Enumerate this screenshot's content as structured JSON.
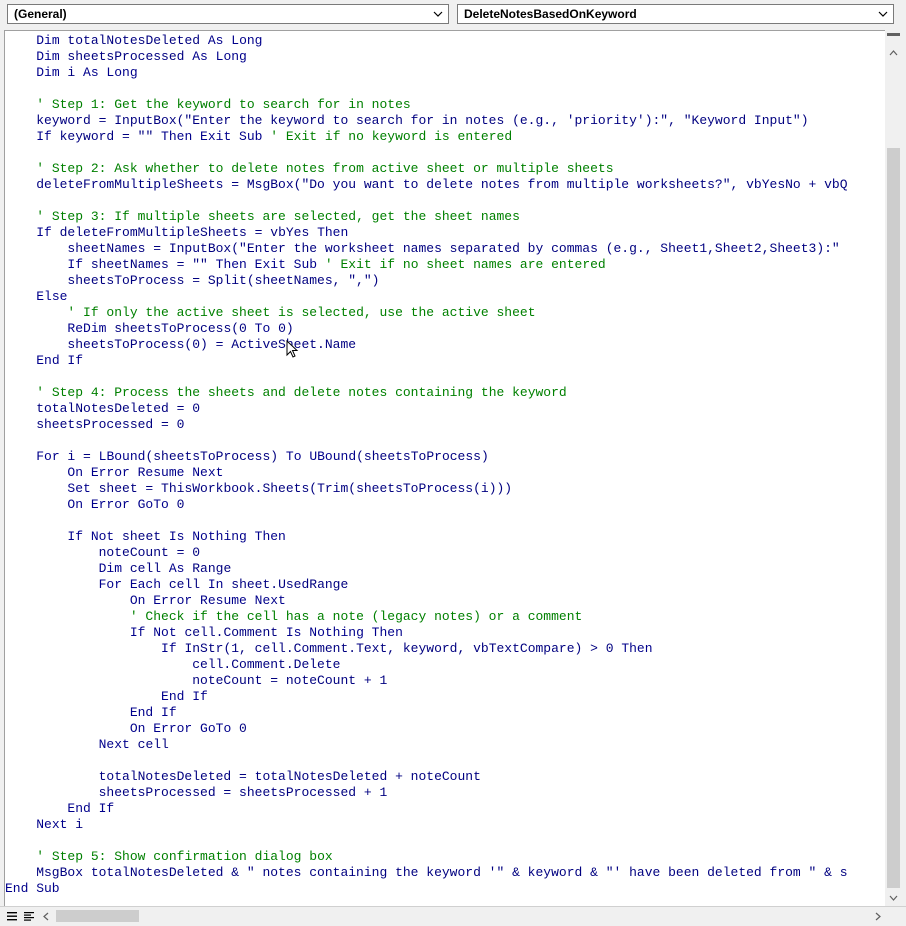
{
  "window": {
    "object_dropdown": "(General)",
    "procedure_dropdown": "DeleteNotesBasedOnKeyword"
  },
  "colors": {
    "keyword": "#00008b",
    "comment": "#008000",
    "text": "#000080"
  },
  "code_lines": [
    [
      {
        "t": "    "
      },
      {
        "k": "Dim"
      },
      {
        "t": " totalNotesDeleted "
      },
      {
        "k": "As Long"
      }
    ],
    [
      {
        "t": "    "
      },
      {
        "k": "Dim"
      },
      {
        "t": " sheetsProcessed "
      },
      {
        "k": "As Long"
      }
    ],
    [
      {
        "t": "    "
      },
      {
        "k": "Dim"
      },
      {
        "t": " i "
      },
      {
        "k": "As Long"
      }
    ],
    [],
    [
      {
        "t": "    "
      },
      {
        "c": "' Step 1: Get the keyword to search for in notes"
      }
    ],
    [
      {
        "t": "    keyword = InputBox(\"Enter the keyword to search for in notes (e.g., 'priority'):\", \"Keyword Input\")"
      }
    ],
    [
      {
        "t": "    "
      },
      {
        "k": "If"
      },
      {
        "t": " keyword = \"\" "
      },
      {
        "k": "Then Exit Sub"
      },
      {
        "t": " "
      },
      {
        "c": "' Exit if no keyword is entered"
      }
    ],
    [],
    [
      {
        "t": "    "
      },
      {
        "c": "' Step 2: Ask whether to delete notes from active sheet or multiple sheets"
      }
    ],
    [
      {
        "t": "    deleteFromMultipleSheets = MsgBox(\"Do you want to delete notes from multiple worksheets?\", vbYesNo + vbQ"
      }
    ],
    [],
    [
      {
        "t": "    "
      },
      {
        "c": "' Step 3: If multiple sheets are selected, get the sheet names"
      }
    ],
    [
      {
        "t": "    "
      },
      {
        "k": "If"
      },
      {
        "t": " deleteFromMultipleSheets = vbYes "
      },
      {
        "k": "Then"
      }
    ],
    [
      {
        "t": "        sheetNames = InputBox(\"Enter the worksheet names separated by commas (e.g., Sheet1,Sheet2,Sheet3):\""
      }
    ],
    [
      {
        "t": "        "
      },
      {
        "k": "If"
      },
      {
        "t": " sheetNames = \"\" "
      },
      {
        "k": "Then Exit Sub"
      },
      {
        "t": " "
      },
      {
        "c": "' Exit if no sheet names are entered"
      }
    ],
    [
      {
        "t": "        sheetsToProcess = Split(sheetNames, \",\")"
      }
    ],
    [
      {
        "t": "    "
      },
      {
        "k": "Else"
      }
    ],
    [
      {
        "t": "        "
      },
      {
        "c": "' If only the active sheet is selected, use the active sheet"
      }
    ],
    [
      {
        "t": "        "
      },
      {
        "k": "ReDim"
      },
      {
        "t": " sheetsToProcess(0 "
      },
      {
        "k": "To"
      },
      {
        "t": " 0)"
      }
    ],
    [
      {
        "t": "        sheetsToProcess(0) = ActiveSheet.Name"
      }
    ],
    [
      {
        "t": "    "
      },
      {
        "k": "End If"
      }
    ],
    [],
    [
      {
        "t": "    "
      },
      {
        "c": "' Step 4: Process the sheets and delete notes containing the keyword"
      }
    ],
    [
      {
        "t": "    totalNotesDeleted = 0"
      }
    ],
    [
      {
        "t": "    sheetsProcessed = 0"
      }
    ],
    [],
    [
      {
        "t": "    "
      },
      {
        "k": "For"
      },
      {
        "t": " i = "
      },
      {
        "k": "LBound"
      },
      {
        "t": "(sheetsToProcess) "
      },
      {
        "k": "To"
      },
      {
        "t": " "
      },
      {
        "k": "UBound"
      },
      {
        "t": "(sheetsToProcess)"
      }
    ],
    [
      {
        "t": "        "
      },
      {
        "k": "On Error Resume Next"
      }
    ],
    [
      {
        "t": "        "
      },
      {
        "k": "Set"
      },
      {
        "t": " sheet = ThisWorkbook.Sheets(Trim(sheetsToProcess(i)))"
      }
    ],
    [
      {
        "t": "        "
      },
      {
        "k": "On Error GoTo"
      },
      {
        "t": " 0"
      }
    ],
    [],
    [
      {
        "t": "        "
      },
      {
        "k": "If Not"
      },
      {
        "t": " sheet "
      },
      {
        "k": "Is Nothing Then"
      }
    ],
    [
      {
        "t": "            noteCount = 0"
      }
    ],
    [
      {
        "t": "            "
      },
      {
        "k": "Dim"
      },
      {
        "t": " cell "
      },
      {
        "k": "As"
      },
      {
        "t": " Range"
      }
    ],
    [
      {
        "t": "            "
      },
      {
        "k": "For Each"
      },
      {
        "t": " cell "
      },
      {
        "k": "In"
      },
      {
        "t": " sheet.UsedRange"
      }
    ],
    [
      {
        "t": "                "
      },
      {
        "k": "On Error Resume Next"
      }
    ],
    [
      {
        "t": "                "
      },
      {
        "c": "' Check if the cell has a note (legacy notes) or a comment"
      }
    ],
    [
      {
        "t": "                "
      },
      {
        "k": "If Not"
      },
      {
        "t": " cell.Comment "
      },
      {
        "k": "Is Nothing Then"
      }
    ],
    [
      {
        "t": "                    "
      },
      {
        "k": "If"
      },
      {
        "t": " InStr(1, cell.Comment.Text, keyword, vbTextCompare) > 0 "
      },
      {
        "k": "Then"
      }
    ],
    [
      {
        "t": "                        cell.Comment.Delete"
      }
    ],
    [
      {
        "t": "                        noteCount = noteCount + 1"
      }
    ],
    [
      {
        "t": "                    "
      },
      {
        "k": "End If"
      }
    ],
    [
      {
        "t": "                "
      },
      {
        "k": "End If"
      }
    ],
    [
      {
        "t": "                "
      },
      {
        "k": "On Error GoTo"
      },
      {
        "t": " 0"
      }
    ],
    [
      {
        "t": "            "
      },
      {
        "k": "Next"
      },
      {
        "t": " cell"
      }
    ],
    [],
    [
      {
        "t": "            totalNotesDeleted = totalNotesDeleted + noteCount"
      }
    ],
    [
      {
        "t": "            sheetsProcessed = sheetsProcessed + 1"
      }
    ],
    [
      {
        "t": "        "
      },
      {
        "k": "End If"
      }
    ],
    [
      {
        "t": "    "
      },
      {
        "k": "Next"
      },
      {
        "t": " i"
      }
    ],
    [],
    [
      {
        "t": "    "
      },
      {
        "c": "' Step 5: Show confirmation dialog box"
      }
    ],
    [
      {
        "t": "    MsgBox totalNotesDeleted & \" notes containing the keyword '\" & keyword & \"' have been deleted from \" & s"
      }
    ],
    [
      {
        "k": "End Sub"
      }
    ]
  ]
}
